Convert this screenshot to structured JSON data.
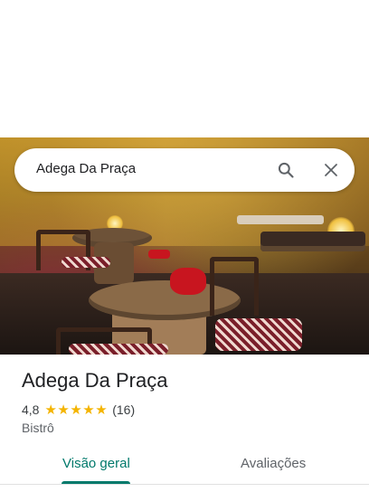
{
  "search": {
    "query": "Adega Da Praça",
    "search_icon": "search-icon",
    "close_icon": "close-icon"
  },
  "place": {
    "name": "Adega Da Praça",
    "rating": "4,8",
    "stars": "★★★★★",
    "review_count": "(16)",
    "category": "Bistrô",
    "rating_value": 4.8
  },
  "tabs": [
    {
      "label": "Visão geral",
      "active": true
    },
    {
      "label": "Avaliações",
      "active": false
    }
  ],
  "colors": {
    "accent": "#00796b",
    "star": "#f4b400",
    "text_primary": "#202124",
    "text_secondary": "#5f6368"
  }
}
